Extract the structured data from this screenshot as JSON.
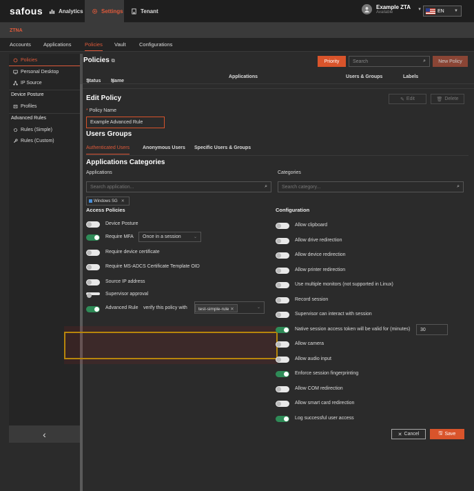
{
  "topbar": {
    "logo": "safous",
    "tabs": [
      {
        "label": "Analytics",
        "icon": "bar-chart-icon"
      },
      {
        "label": "Settings",
        "icon": "gear-icon"
      },
      {
        "label": "Tenant",
        "icon": "building-icon"
      }
    ],
    "user": {
      "name": "Example ZTA",
      "status": "Available"
    },
    "language": "EN"
  },
  "section_title": "ZTNA",
  "subnav": [
    "Accounts",
    "Applications",
    "Policies",
    "Vault",
    "Configurations"
  ],
  "sidebar": {
    "items": [
      {
        "label": "Policies",
        "icon": "policy-icon"
      },
      {
        "label": "Personal Desktop",
        "icon": "monitor-icon"
      },
      {
        "label": "IP Source",
        "icon": "network-icon"
      }
    ],
    "device_posture": {
      "heading": "Device Posture",
      "items": [
        {
          "label": "Profiles",
          "icon": "profile-icon"
        }
      ]
    },
    "advanced_rules": {
      "heading": "Advanced Rules",
      "items": [
        {
          "label": "Rules (Simple)",
          "icon": "rule-icon"
        },
        {
          "label": "Rules (Custom)",
          "icon": "wrench-icon"
        }
      ]
    },
    "back": "‹"
  },
  "main": {
    "title": "Policies",
    "priority_label": "Priority",
    "search_placeholder": "Search",
    "new_policy_label": "New Policy",
    "table_headers": {
      "status": "Status",
      "name": "Name",
      "applications": "Applications",
      "users_groups": "Users & Groups",
      "labels": "Labels"
    }
  },
  "edit": {
    "title": "Edit Policy",
    "edit_label": "Edit",
    "delete_label": "Delete",
    "policy_name_label": "Policy Name",
    "policy_name_value": "Example Advanced Rule",
    "users_groups_title": "Users Groups",
    "user_tabs": [
      "Authenticated Users",
      "Anonymous Users",
      "Specific Users & Groups"
    ],
    "app_categories_title": "Applications Categories",
    "applications_label": "Applications",
    "categories_label": "Categories",
    "search_app_placeholder": "Search application...",
    "search_cat_placeholder": "Search category...",
    "chip_label": "Windows SG",
    "access_policies_title": "Access Policies",
    "access_policies": [
      {
        "label": "Device Posture",
        "on": false
      },
      {
        "label": "Require MFA",
        "on": true
      },
      {
        "label": "Require device certificate",
        "on": false
      },
      {
        "label": "Require MS-ADCS Certificate Template OID",
        "on": false
      },
      {
        "label": "Source IP address",
        "on": false
      },
      {
        "label": "Supervisor approval",
        "on": false
      },
      {
        "label": "Advanced Rule",
        "on": true
      }
    ],
    "mfa_select": "Once in a session",
    "advanced_rule_text": "verify this policy with",
    "advanced_rule_tag": "test-simple-rule",
    "configuration_title": "Configuration",
    "configuration": [
      {
        "label": "Allow clipboard",
        "on": false
      },
      {
        "label": "Allow drive redirection",
        "on": false
      },
      {
        "label": "Allow device redirection",
        "on": false
      },
      {
        "label": "Allow printer redirection",
        "on": false
      },
      {
        "label": "Use multiple monitors (not supported in Linux)",
        "on": false
      },
      {
        "label": "Record session",
        "on": false
      },
      {
        "label": "Supervisor can interact with session",
        "on": false
      },
      {
        "label": "Native session access token will be valid for (minutes)",
        "on": true
      },
      {
        "label": "Allow camera",
        "on": false
      },
      {
        "label": "Allow audio input",
        "on": false
      },
      {
        "label": "Enforce session fingerprinting",
        "on": true
      },
      {
        "label": "Allow COM redirection",
        "on": false
      },
      {
        "label": "Allow smart card redirection",
        "on": false
      },
      {
        "label": "Log successful user access",
        "on": true
      }
    ],
    "token_minutes": "30",
    "cancel_label": "Cancel",
    "save_label": "Save"
  },
  "colors": {
    "accent": "#d9542b",
    "toggle_on": "#2e8b57",
    "highlight": "#b8860b"
  }
}
